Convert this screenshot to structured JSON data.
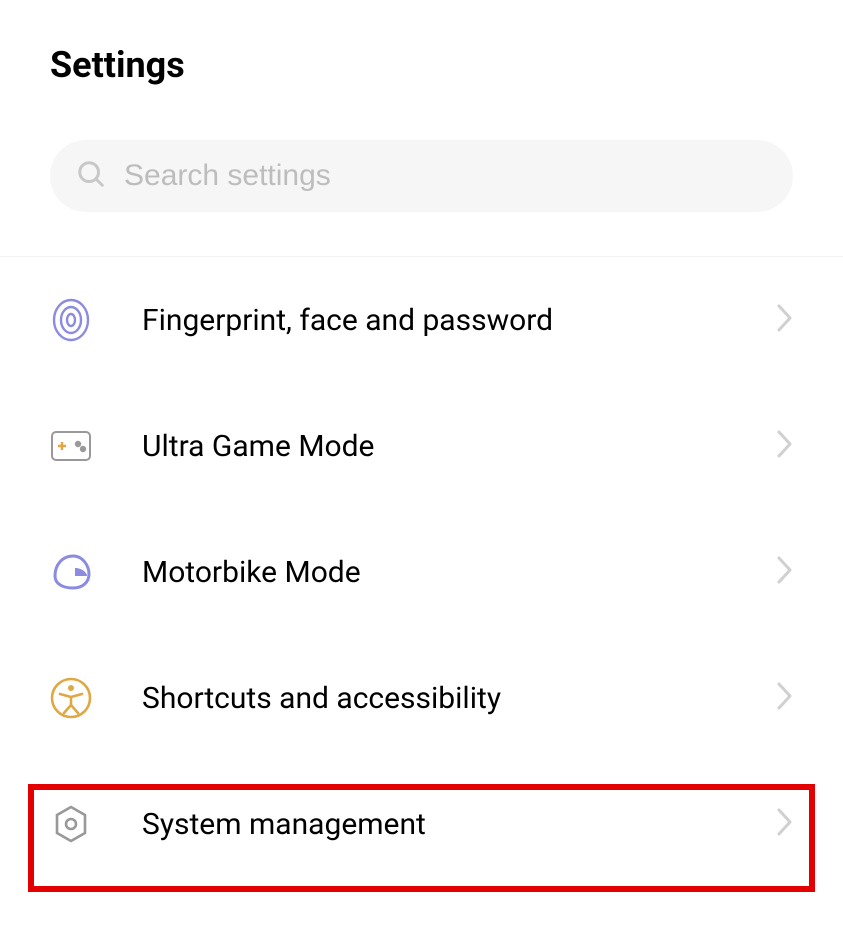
{
  "title": "Settings",
  "search": {
    "placeholder": "Search settings"
  },
  "items": [
    {
      "label": "Fingerprint, face and password"
    },
    {
      "label": "Ultra Game Mode"
    },
    {
      "label": "Motorbike Mode"
    },
    {
      "label": "Shortcuts and accessibility"
    },
    {
      "label": "System management"
    }
  ]
}
